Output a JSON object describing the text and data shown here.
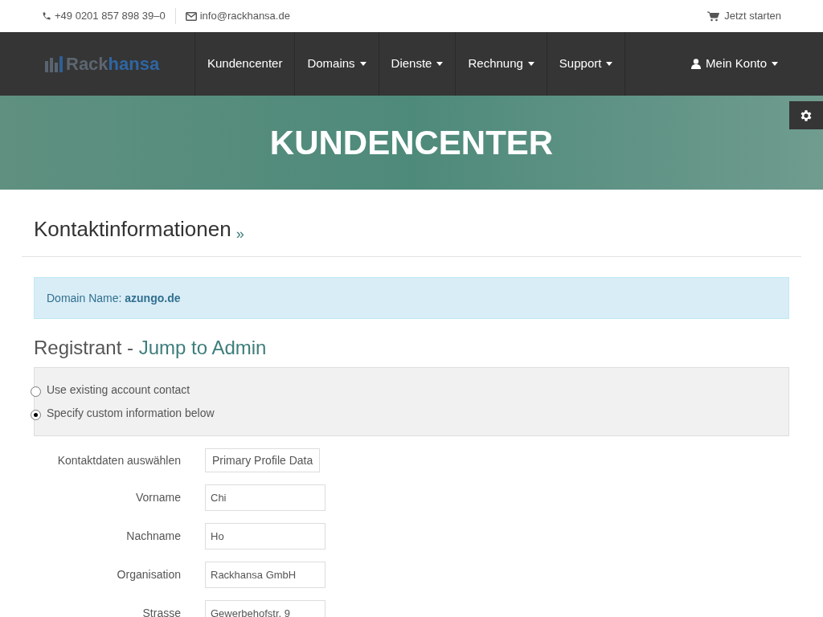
{
  "topbar": {
    "phone": "+49 0201 857 898 39–0",
    "email": "info@rackhansa.de",
    "cart": "Jetzt starten"
  },
  "logo": {
    "part_1": "Rack",
    "part_2": "hansa"
  },
  "nav": [
    {
      "label": "Kundencenter",
      "dropdown": false
    },
    {
      "label": "Domains",
      "dropdown": true
    },
    {
      "label": "Dienste",
      "dropdown": true
    },
    {
      "label": "Rechnung",
      "dropdown": true
    },
    {
      "label": "Support",
      "dropdown": true
    }
  ],
  "account": {
    "label": "Mein Konto",
    "dropdown": true
  },
  "hero": {
    "title": "KUNDENCENTER"
  },
  "page": {
    "title": "Kontaktinformationen",
    "suffix": "»"
  },
  "alert": {
    "label": "Domain Name:",
    "value": "azungo.de"
  },
  "section": {
    "title": "Registrant - ",
    "link": "Jump to Admin"
  },
  "options": [
    {
      "label": "Use existing account contact",
      "selected": false
    },
    {
      "label": "Specify custom information below",
      "selected": true
    }
  ],
  "fields": [
    {
      "kind": "select",
      "label": "Kontaktdaten auswählen",
      "value": "Primary Profile Data"
    },
    {
      "kind": "text",
      "label": "Vorname",
      "value": "Chi"
    },
    {
      "kind": "text",
      "label": "Nachname",
      "value": "Ho"
    },
    {
      "kind": "text",
      "label": "Organisation",
      "value": "Rackhansa GmbH"
    },
    {
      "kind": "text",
      "label": "Strasse",
      "value": "Gewerbehofstr. 9"
    }
  ]
}
